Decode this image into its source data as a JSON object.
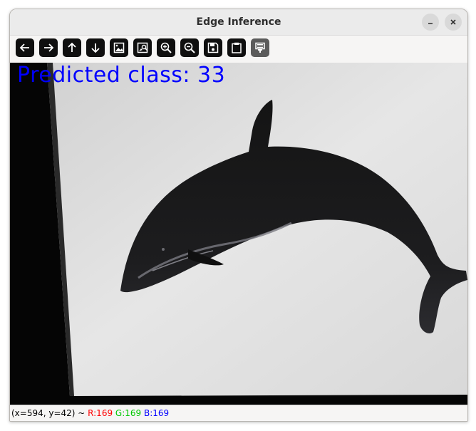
{
  "window": {
    "title": "Edge Inference",
    "minimize_icon": "minimize-icon",
    "close_icon": "close-icon"
  },
  "toolbar": {
    "buttons": [
      {
        "icon": "arrow-left-icon"
      },
      {
        "icon": "arrow-right-icon"
      },
      {
        "icon": "arrow-up-icon"
      },
      {
        "icon": "arrow-down-icon"
      },
      {
        "icon": "image-icon"
      },
      {
        "icon": "image-properties-icon"
      },
      {
        "icon": "zoom-in-icon"
      },
      {
        "icon": "zoom-out-icon"
      },
      {
        "icon": "save-icon"
      },
      {
        "icon": "clipboard-icon"
      },
      {
        "icon": "properties-icon"
      }
    ]
  },
  "image": {
    "overlay_text": "Predicted class: 33",
    "overlay_color": "#0000ff"
  },
  "status": {
    "coords": "(x=594, y=42) ~ ",
    "r": "R:169",
    "g": "G:169",
    "b": "B:169"
  }
}
